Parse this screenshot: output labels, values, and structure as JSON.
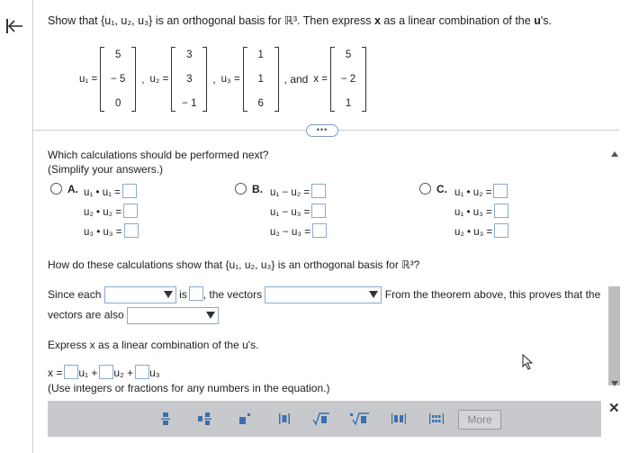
{
  "question": {
    "prefix": "Show that",
    "set": "{u₁, u₂, u₃}",
    "middle": "is an orthogonal basis for",
    "space": "ℝ³",
    "suffix": ". Then express",
    "x": "x",
    "suffix2": "as a linear combination of the",
    "us": "u",
    "suffix3": "'s."
  },
  "vectors": {
    "u1": {
      "label": "u₁ =",
      "values": [
        "5",
        "− 5",
        "0"
      ]
    },
    "u2": {
      "label": "u₂ =",
      "values": [
        "3",
        "3",
        "− 1"
      ]
    },
    "u3": {
      "label": "u₃ =",
      "values": [
        "1",
        "1",
        "6"
      ]
    },
    "and": ", and",
    "x": {
      "label": "x =",
      "values": [
        "5",
        "− 2",
        "1"
      ]
    }
  },
  "more_pill": "•••",
  "part1": {
    "question": "Which calculations should be performed next?",
    "hint": "(Simplify your answers.)",
    "options": [
      {
        "letter": "A.",
        "lines": [
          "u₁ • u₁ =",
          "u₂ • u₂ =",
          "u₃ • u₃ ="
        ]
      },
      {
        "letter": "B.",
        "lines": [
          "u₁ − u₂ =",
          "u₁ − u₃ =",
          "u₂ − u₃ ="
        ]
      },
      {
        "letter": "C.",
        "lines": [
          "u₁ • u₂ =",
          "u₁ • u₃ =",
          "u₂ • u₃ ="
        ]
      }
    ]
  },
  "part2": {
    "question": "How do these calculations show that {u₁, u₂, u₃} is an orthogonal basis for ℝ³?",
    "since_each": "Since each",
    "is": "is",
    "the_vectors": ", the vectors",
    "theorem": "From the theorem above, this proves that the",
    "vectors_also": "vectors are also"
  },
  "part3": {
    "question": "Express x as a linear combination of the u's.",
    "x_eq": "x =",
    "terms": [
      "u₁ +",
      "u₂ +",
      "u₃"
    ],
    "note": "(Use integers or fractions for any numbers in the equation.)"
  },
  "toolbar": {
    "buttons": [
      "fraction-icon",
      "mixed-number-icon",
      "exponent-icon",
      "absolute-value-icon",
      "sqrt-icon",
      "nth-root-icon",
      "decimal-icon",
      "matrix-icon"
    ],
    "more_label": "More",
    "accent": "#3a6fb0"
  },
  "close_label": "✕"
}
